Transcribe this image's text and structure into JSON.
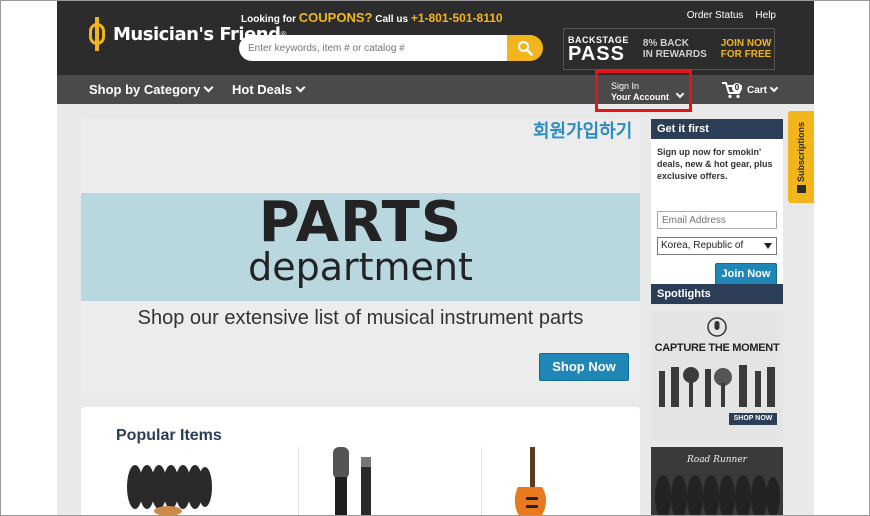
{
  "header": {
    "logo_text": "Musician's Friend",
    "logo_reg": "®",
    "coupon_prefix": "Looking for",
    "coupon_word": "COUPONS?",
    "coupon_call": "Call us",
    "phone": "+1-801-501-8110",
    "search_placeholder": "Enter keywords, item # or catalog #",
    "links": [
      "Order Status",
      "Help"
    ],
    "pass_small": "BACKSTAGE",
    "pass_big": "PASS",
    "pass_mid_1": "8% BACK",
    "pass_mid_2": "IN REWARDS",
    "pass_right_1": "JOIN NOW",
    "pass_right_2": "FOR FREE"
  },
  "nav": {
    "shop_by_category": "Shop by Category",
    "hot_deals": "Hot Deals",
    "sign_in": "Sign In",
    "your_account": "Your Account",
    "cart_count": "0",
    "cart_label": "Cart"
  },
  "annotation": {
    "overlay_text": "회원가입하기",
    "highlight_color": "#e4141b",
    "overlay_color": "#2b8ec2"
  },
  "hero": {
    "title": "PARTS",
    "subtitle": "department",
    "tagline": "Shop our extensive list of musical instrument parts",
    "button": "Shop Now"
  },
  "popular": {
    "title": "Popular Items"
  },
  "signup": {
    "title": "Get it first",
    "copy": "Sign up now for smokin' deals, new & hot gear, plus exclusive offers.",
    "email_placeholder": "Email Address",
    "country": "Korea, Republic of",
    "button": "Join Now"
  },
  "spotlights": {
    "title": "Spotlights",
    "card1_title": "CAPTURE THE MOMENT",
    "card1_button": "SHOP NOW",
    "card2_title": "Road Runner"
  },
  "subscriptions": {
    "label": "Subscriptions"
  },
  "colors": {
    "accent": "#f2b51b",
    "header_bg": "#2c2c2c",
    "nav_bg": "#4a4a4a",
    "button_blue": "#1e87b8",
    "panel_head": "#2c3d57"
  }
}
